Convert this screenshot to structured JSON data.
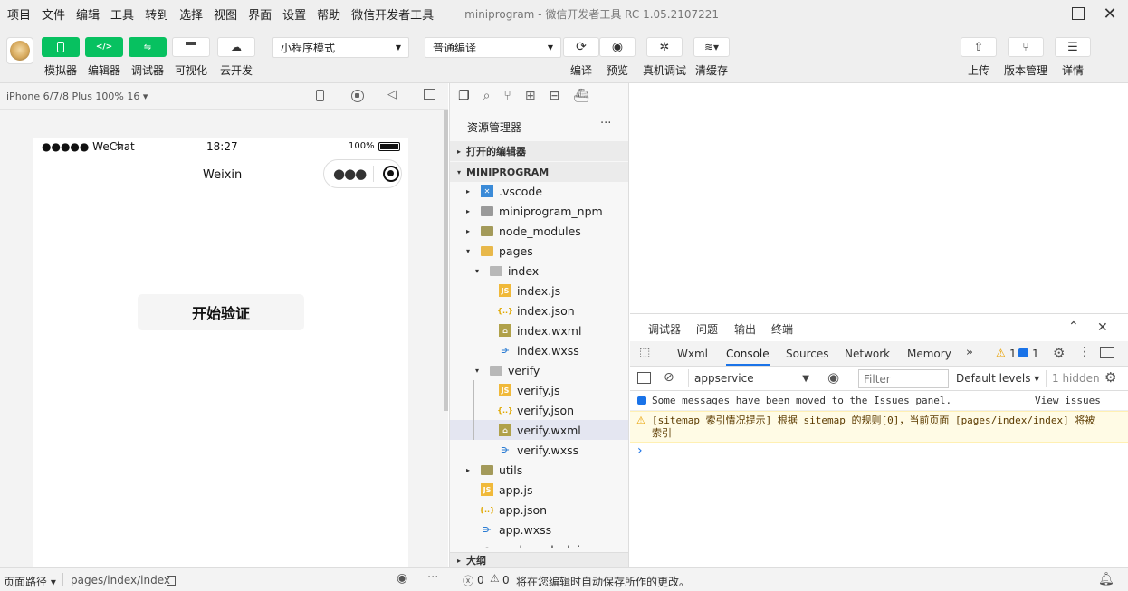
{
  "menubar": {
    "items": [
      "项目",
      "文件",
      "编辑",
      "工具",
      "转到",
      "选择",
      "视图",
      "界面",
      "设置",
      "帮助",
      "微信开发者工具"
    ],
    "title": "miniprogram - 微信开发者工具 RC 1.05.2107221"
  },
  "toolbar": {
    "simulator": "模拟器",
    "editor": "编辑器",
    "debugger": "调试器",
    "visual": "可视化",
    "cloud": "云开发",
    "mode": "小程序模式",
    "compile_mode": "普通编译",
    "compile": "编译",
    "preview": "预览",
    "real_debug": "真机调试",
    "clear_cache": "清缓存",
    "upload": "上传",
    "version": "版本管理",
    "details": "详情"
  },
  "simulator": {
    "device": "iPhone 6/7/8 Plus 100% 16 ▾",
    "carrier": "●●●●● WeChat",
    "time": "18:27",
    "battery": "100%",
    "nav_title": "Weixin",
    "button": "开始验证"
  },
  "explorer": {
    "title": "资源管理器",
    "more": "···",
    "open_editors": "打开的编辑器",
    "project": "MINIPROGRAM",
    "outline": "大纲",
    "files": [
      {
        "name": ".vscode",
        "indent": 0,
        "caret": "▸",
        "icon": "vscode"
      },
      {
        "name": "miniprogram_npm",
        "indent": 0,
        "caret": "▸",
        "icon": "folder"
      },
      {
        "name": "node_modules",
        "indent": 0,
        "caret": "▸",
        "icon": "folder-node"
      },
      {
        "name": "pages",
        "indent": 0,
        "caret": "▾",
        "icon": "folder-open"
      },
      {
        "name": "index",
        "indent": 1,
        "caret": "▾",
        "icon": "folder-open-grey"
      },
      {
        "name": "index.js",
        "indent": 2,
        "caret": "",
        "icon": "js"
      },
      {
        "name": "index.json",
        "indent": 2,
        "caret": "",
        "icon": "json"
      },
      {
        "name": "index.wxml",
        "indent": 2,
        "caret": "",
        "icon": "wxml"
      },
      {
        "name": "index.wxss",
        "indent": 2,
        "caret": "",
        "icon": "wxss"
      },
      {
        "name": "verify",
        "indent": 1,
        "caret": "▾",
        "icon": "folder-open-grey"
      },
      {
        "name": "verify.js",
        "indent": 2,
        "caret": "",
        "icon": "js"
      },
      {
        "name": "verify.json",
        "indent": 2,
        "caret": "",
        "icon": "json"
      },
      {
        "name": "verify.wxml",
        "indent": 2,
        "caret": "",
        "icon": "wxml",
        "selected": true
      },
      {
        "name": "verify.wxss",
        "indent": 2,
        "caret": "",
        "icon": "wxss"
      },
      {
        "name": "utils",
        "indent": 0,
        "caret": "▸",
        "icon": "folder-utils"
      },
      {
        "name": "app.js",
        "indent": 0,
        "caret": "",
        "icon": "js"
      },
      {
        "name": "app.json",
        "indent": 0,
        "caret": "",
        "icon": "json"
      },
      {
        "name": "app.wxss",
        "indent": 0,
        "caret": "",
        "icon": "wxss"
      },
      {
        "name": "package-lock.json",
        "indent": 0,
        "caret": "",
        "icon": "pkg"
      }
    ]
  },
  "devtools": {
    "top_tabs": [
      "调试器",
      "问题",
      "输出",
      "终端"
    ],
    "tabs": [
      "Wxml",
      "Console",
      "Sources",
      "Network",
      "Memory"
    ],
    "more_tabs": "»",
    "warn_count": "1",
    "info_count": "1",
    "context": "appservice",
    "filter_placeholder": "Filter",
    "levels": "Default levels ▾",
    "hidden": "1 hidden",
    "msg1": "Some messages have been moved to the Issues panel.",
    "msg1_link": "View issues",
    "msg2": "[sitemap 索引情况提示] 根据 sitemap 的规则[0]，当前页面 [pages/index/index] 将被索引",
    "prompt": "›"
  },
  "statusbar": {
    "path_label": "页面路径 ▾",
    "path": "pages/index/index",
    "errors": "0",
    "warnings": "0",
    "message": "将在您编辑时自动保存所作的更改。"
  },
  "colors": {
    "green": "#07c160",
    "selected": "#e4e6f1",
    "warn_bg": "#fffbe5"
  }
}
